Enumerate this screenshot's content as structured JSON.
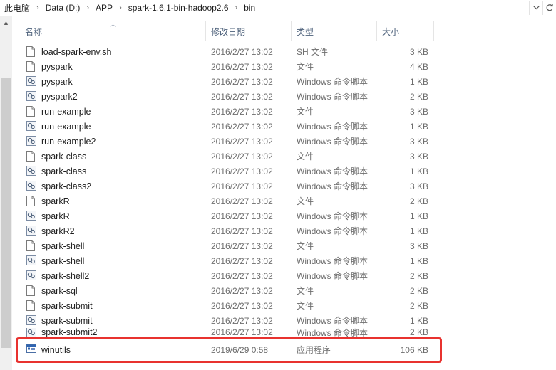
{
  "address_bar": {
    "crumbs": [
      "此电脑",
      "Data (D:)",
      "APP",
      "spark-1.6.1-bin-hadoop2.6",
      "bin"
    ],
    "dropdown_icon": "chevron-down-icon",
    "refresh_icon": "refresh-icon"
  },
  "columns": {
    "name": "名称",
    "date": "修改日期",
    "type": "类型",
    "size": "大小"
  },
  "files": [
    {
      "name": "load-spark-env.sh",
      "date": "2016/2/27 13:02",
      "type": "SH 文件",
      "size": "3 KB",
      "icon": "file-icon"
    },
    {
      "name": "pyspark",
      "date": "2016/2/27 13:02",
      "type": "文件",
      "size": "4 KB",
      "icon": "file-icon"
    },
    {
      "name": "pyspark",
      "date": "2016/2/27 13:02",
      "type": "Windows 命令脚本",
      "size": "1 KB",
      "icon": "script-icon"
    },
    {
      "name": "pyspark2",
      "date": "2016/2/27 13:02",
      "type": "Windows 命令脚本",
      "size": "2 KB",
      "icon": "script-icon"
    },
    {
      "name": "run-example",
      "date": "2016/2/27 13:02",
      "type": "文件",
      "size": "3 KB",
      "icon": "file-icon"
    },
    {
      "name": "run-example",
      "date": "2016/2/27 13:02",
      "type": "Windows 命令脚本",
      "size": "1 KB",
      "icon": "script-icon"
    },
    {
      "name": "run-example2",
      "date": "2016/2/27 13:02",
      "type": "Windows 命令脚本",
      "size": "3 KB",
      "icon": "script-icon"
    },
    {
      "name": "spark-class",
      "date": "2016/2/27 13:02",
      "type": "文件",
      "size": "3 KB",
      "icon": "file-icon"
    },
    {
      "name": "spark-class",
      "date": "2016/2/27 13:02",
      "type": "Windows 命令脚本",
      "size": "1 KB",
      "icon": "script-icon"
    },
    {
      "name": "spark-class2",
      "date": "2016/2/27 13:02",
      "type": "Windows 命令脚本",
      "size": "3 KB",
      "icon": "script-icon"
    },
    {
      "name": "sparkR",
      "date": "2016/2/27 13:02",
      "type": "文件",
      "size": "2 KB",
      "icon": "file-icon"
    },
    {
      "name": "sparkR",
      "date": "2016/2/27 13:02",
      "type": "Windows 命令脚本",
      "size": "1 KB",
      "icon": "script-icon"
    },
    {
      "name": "sparkR2",
      "date": "2016/2/27 13:02",
      "type": "Windows 命令脚本",
      "size": "1 KB",
      "icon": "script-icon"
    },
    {
      "name": "spark-shell",
      "date": "2016/2/27 13:02",
      "type": "文件",
      "size": "3 KB",
      "icon": "file-icon"
    },
    {
      "name": "spark-shell",
      "date": "2016/2/27 13:02",
      "type": "Windows 命令脚本",
      "size": "1 KB",
      "icon": "script-icon"
    },
    {
      "name": "spark-shell2",
      "date": "2016/2/27 13:02",
      "type": "Windows 命令脚本",
      "size": "2 KB",
      "icon": "script-icon"
    },
    {
      "name": "spark-sql",
      "date": "2016/2/27 13:02",
      "type": "文件",
      "size": "2 KB",
      "icon": "file-icon"
    },
    {
      "name": "spark-submit",
      "date": "2016/2/27 13:02",
      "type": "文件",
      "size": "2 KB",
      "icon": "file-icon"
    },
    {
      "name": "spark-submit",
      "date": "2016/2/27 13:02",
      "type": "Windows 命令脚本",
      "size": "1 KB",
      "icon": "script-icon"
    },
    {
      "name": "spark-submit2",
      "date": "2016/2/27 13:02",
      "type": "Windows 命令脚本",
      "size": "2 KB",
      "icon": "script-icon"
    }
  ],
  "highlighted_file": {
    "name": "winutils",
    "date": "2019/6/29 0:58",
    "type": "应用程序",
    "size": "106 KB",
    "icon": "application-icon"
  },
  "colors": {
    "highlight_border": "#e8322f",
    "header_text": "#4c607a"
  }
}
